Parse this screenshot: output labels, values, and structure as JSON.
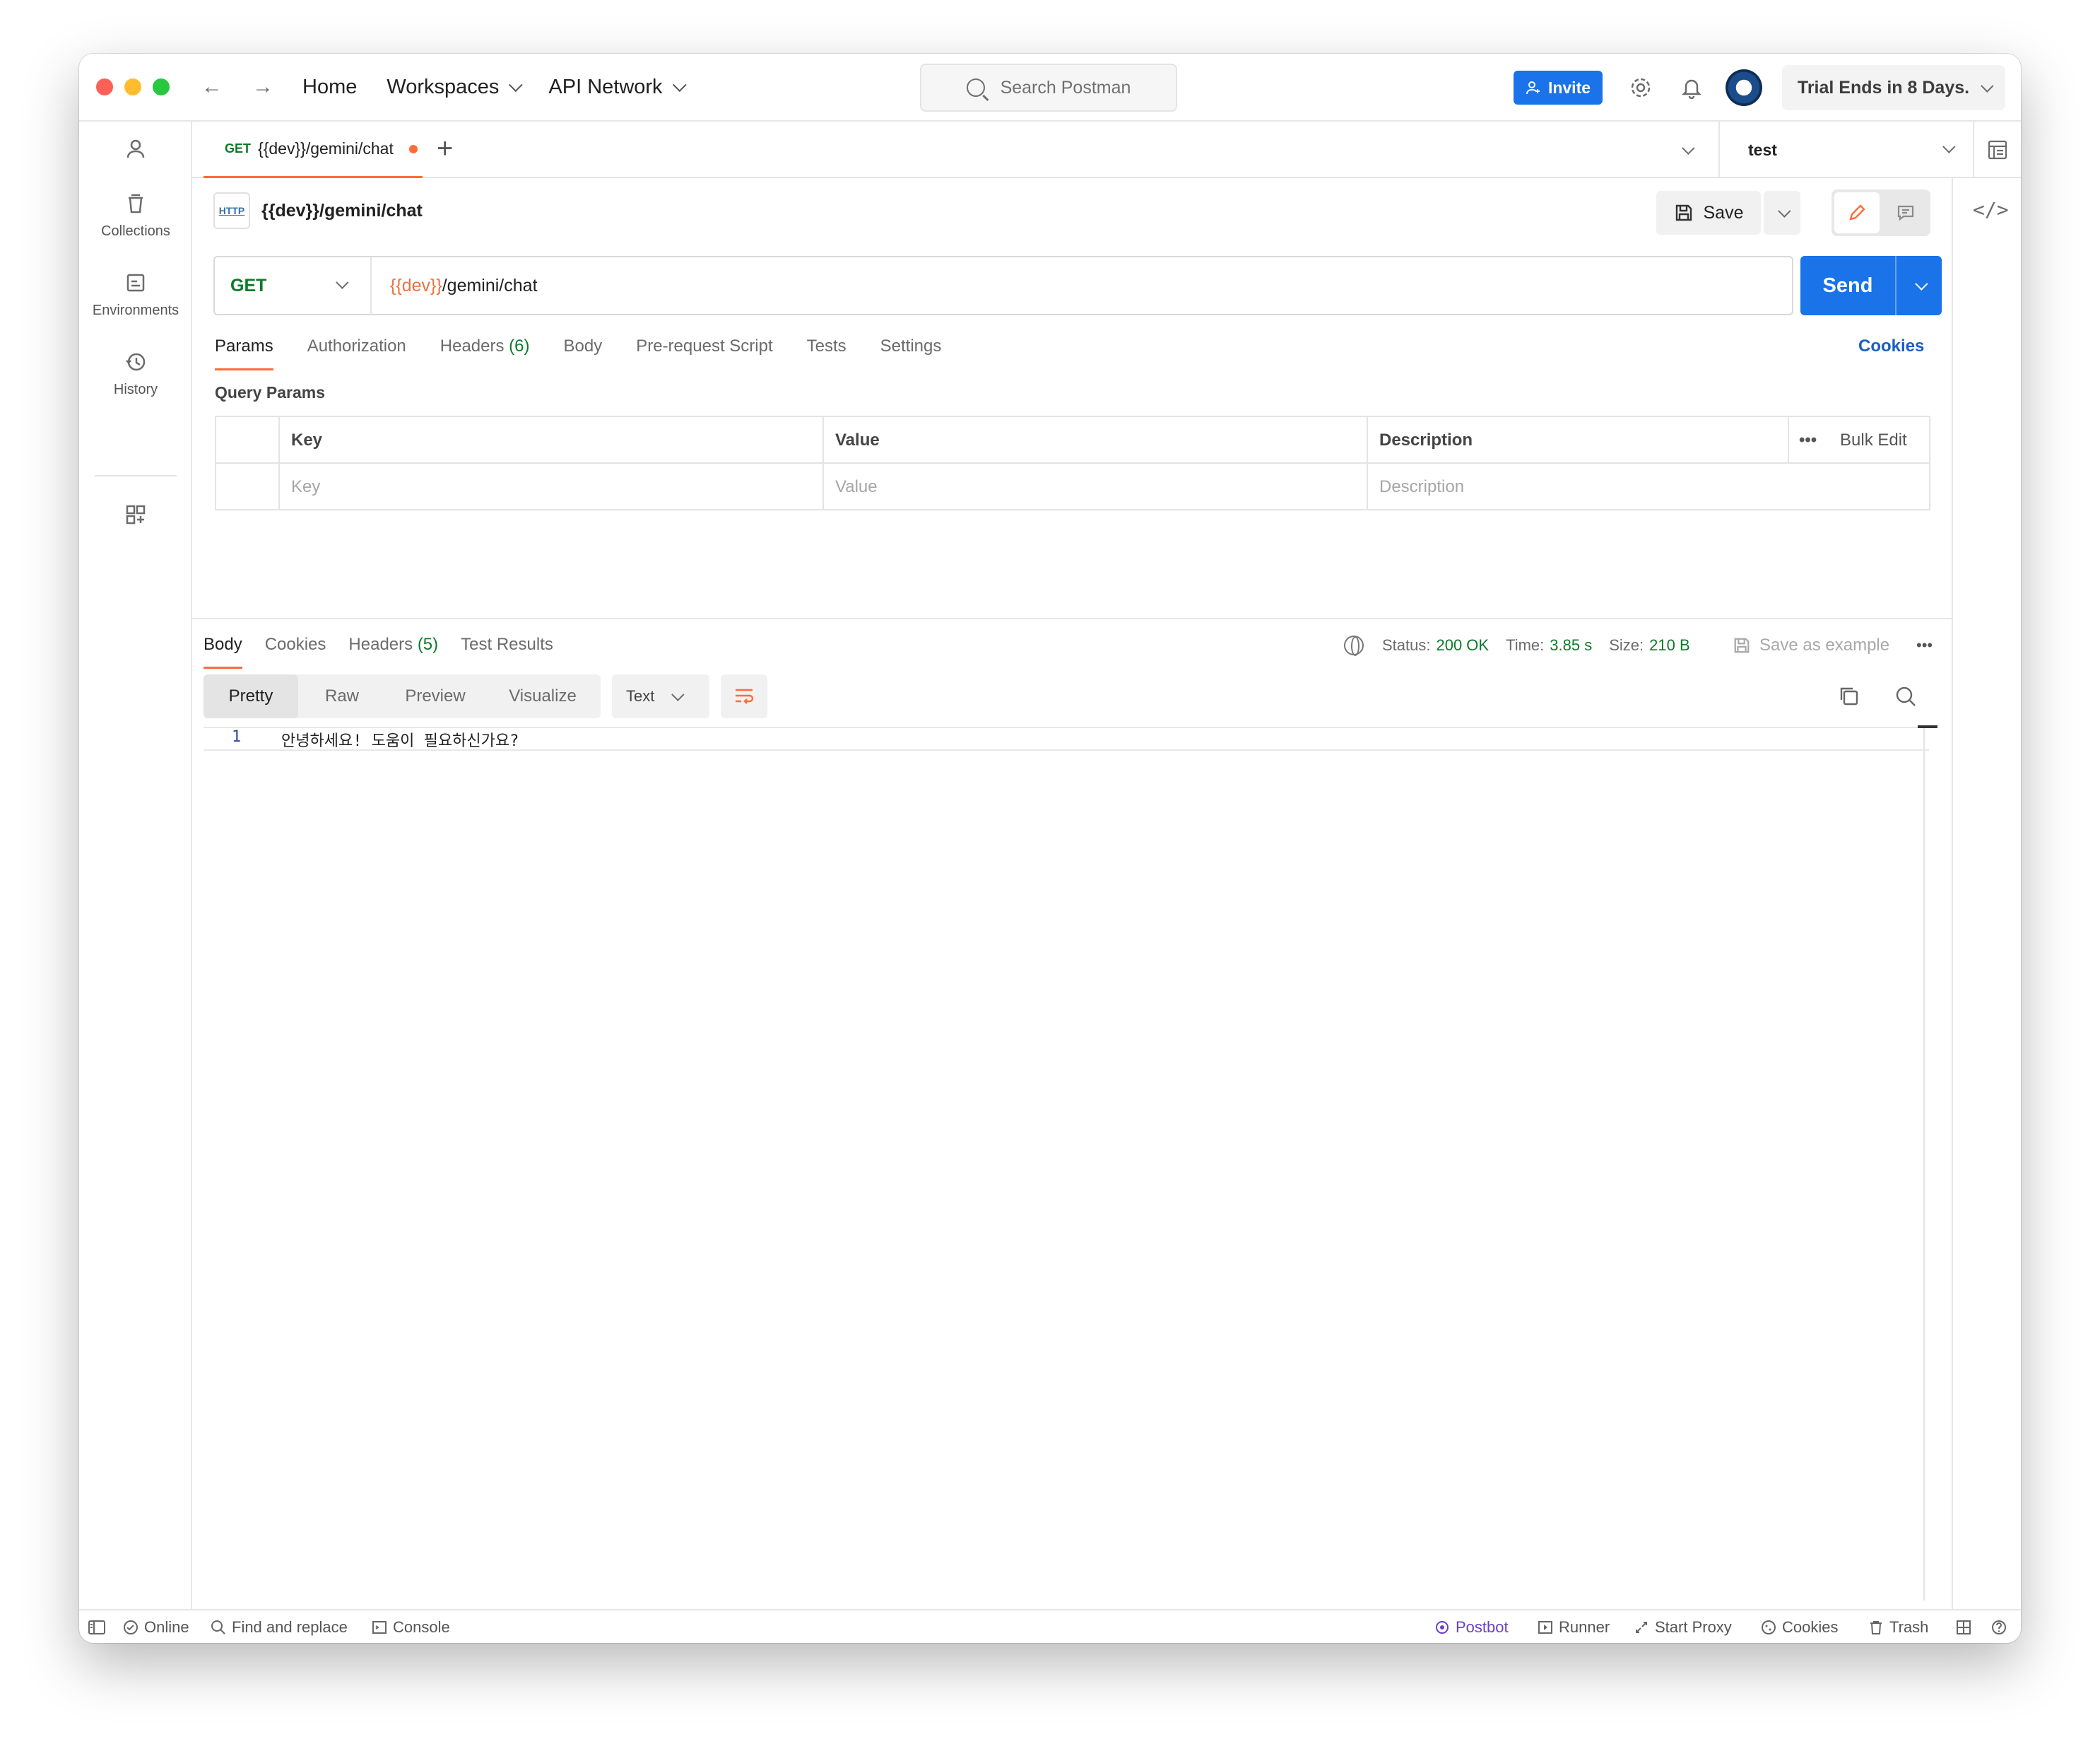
{
  "topbar": {
    "nav": {
      "home": "Home",
      "workspaces": "Workspaces",
      "api_network": "API Network"
    },
    "search_placeholder": "Search Postman",
    "invite_label": "Invite",
    "trial_label": "Trial Ends in 8 Days."
  },
  "sidebar": {
    "items": [
      {
        "label": "",
        "icon": "user-icon"
      },
      {
        "label": "Collections",
        "icon": "collections-icon"
      },
      {
        "label": "Environments",
        "icon": "environments-icon"
      },
      {
        "label": "History",
        "icon": "history-icon"
      },
      {
        "label": "",
        "icon": "apps-icon"
      }
    ]
  },
  "tabs": {
    "active": {
      "method": "GET",
      "title": "{{dev}}/gemini/chat"
    },
    "environment": "test"
  },
  "request": {
    "title": "{{dev}}/gemini/chat",
    "http_badge": "HTTP",
    "save_label": "Save",
    "method": "GET",
    "url_variable": "{{dev}}",
    "url_path": "/gemini/chat",
    "send_label": "Send",
    "tabs": [
      "Params",
      "Authorization",
      "Headers",
      "Body",
      "Pre-request Script",
      "Tests",
      "Settings"
    ],
    "headers_count": "(6)",
    "cookies_label": "Cookies",
    "query_params_label": "Query Params",
    "table": {
      "headers": [
        "Key",
        "Value",
        "Description"
      ],
      "placeholders": [
        "Key",
        "Value",
        "Description"
      ],
      "bulk_edit": "Bulk Edit"
    }
  },
  "response": {
    "tabs": [
      "Body",
      "Cookies",
      "Headers",
      "Test Results"
    ],
    "headers_count": "(5)",
    "status_label": "Status:",
    "status_value": "200 OK",
    "time_label": "Time:",
    "time_value": "3.85 s",
    "size_label": "Size:",
    "size_value": "210 B",
    "save_example": "Save as example",
    "views": [
      "Pretty",
      "Raw",
      "Preview",
      "Visualize"
    ],
    "format": "Text",
    "line_number": "1",
    "line_text": "안녕하세요! 도움이 필요하신가요?"
  },
  "statusbar": {
    "online": "Online",
    "find_replace": "Find and replace",
    "console": "Console",
    "postbot": "Postbot",
    "runner": "Runner",
    "start_proxy": "Start Proxy",
    "cookies": "Cookies",
    "trash": "Trash"
  },
  "colors": {
    "accent": "#ff6c37",
    "primary": "#1a73e8",
    "success": "#0d7a2a",
    "postbot": "#6b3fc7"
  }
}
